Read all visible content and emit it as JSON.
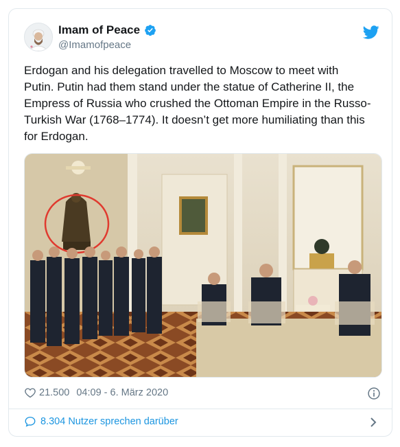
{
  "user": {
    "name": "Imam of Peace",
    "handle": "@Imamofpeace"
  },
  "tweet": {
    "lines": [
      "Erdogan and his delegation travelled to Moscow to meet with",
      "Putin. Putin had them stand under the statue of Catherine II, the",
      "Empress of Russia who crushed the Ottoman Empire in the Russo-",
      "Turkish War (1768–1774). It doesn’t get more humiliating than this",
      "for Erdogan."
    ]
  },
  "photo": {
    "description_icon": "photo-image"
  },
  "meta": {
    "likes": "21.500",
    "timestamp": "04:09 - 6. März 2020"
  },
  "footer": {
    "conversation": "8.304 Nutzer sprechen darüber"
  },
  "colors": {
    "accent": "#1da1f2",
    "link": "#1b95e0",
    "muted": "#657786",
    "border": "#e1e8ed"
  },
  "icons": [
    "verified-badge-icon",
    "twitter-bird-icon",
    "heart-icon",
    "info-icon",
    "speech-bubble-icon",
    "chevron-right-icon"
  ]
}
